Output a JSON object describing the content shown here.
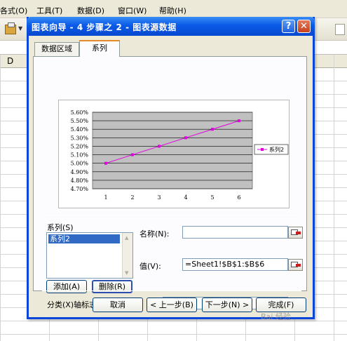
{
  "menu": [
    "各式(O)",
    "工具(T)",
    "数据(D)",
    "窗口(W)",
    "帮助(H)"
  ],
  "column_header": "D",
  "dialog": {
    "title": "图表向导 - 4 步骤之 2 - 图表源数据",
    "help_label": "?",
    "close_label": "✕",
    "tabs": [
      {
        "label": "数据区域",
        "active": false
      },
      {
        "label": "系列",
        "active": true
      }
    ]
  },
  "chart_data": {
    "type": "line",
    "x": [
      1,
      2,
      3,
      4,
      5,
      6
    ],
    "y_ticks": [
      "5.60%",
      "5.50%",
      "5.40%",
      "5.30%",
      "5.20%",
      "5.10%",
      "5.00%",
      "4.90%",
      "4.80%",
      "4.70%"
    ],
    "ylim": [
      0.047,
      0.056
    ],
    "series": [
      {
        "name": "系列2",
        "values": [
          0.05,
          0.051,
          0.052,
          0.053,
          0.054,
          0.055
        ],
        "color": "#e000e0"
      }
    ],
    "plot_background": "#c0c0c0",
    "grid": true,
    "legend": "right"
  },
  "series_panel": {
    "label": "系列(S)",
    "items": [
      "系列2"
    ],
    "add_label": "添加(A)",
    "remove_label": "删除(R)"
  },
  "fields": {
    "name_label": "名称(N):",
    "name_value": "",
    "value_label": "值(V):",
    "value_value": "=Sheet1!$B$1:$B$6",
    "category_label": "分类(X)轴标志(T):",
    "category_value": ""
  },
  "buttons": {
    "cancel": "取消",
    "back": "< 上一步(B)",
    "next": "下一步(N) >",
    "finish": "完成(F)"
  },
  "watermark": "Bai 经验"
}
